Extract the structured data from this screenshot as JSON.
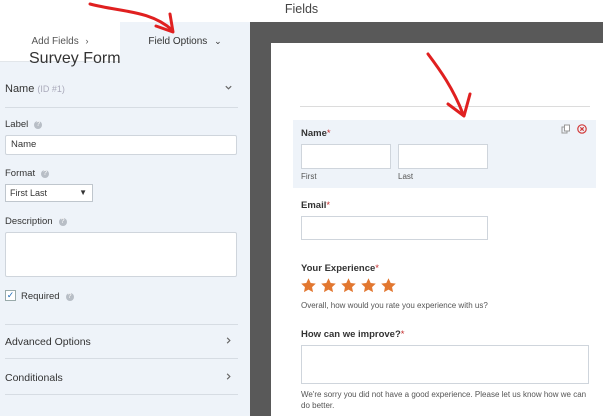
{
  "window": {
    "title": "Fields"
  },
  "tabs": {
    "add_fields": "Add Fields",
    "add_fields_caret": "›",
    "field_options": "Field Options",
    "field_options_caret": "⌄"
  },
  "options": {
    "field_name": "Name",
    "field_id": "(ID #1)",
    "label_title": "Label",
    "label_value": "Name",
    "format_title": "Format",
    "format_value": "First Last",
    "description_title": "Description",
    "description_value": "",
    "required_label": "Required",
    "required_checked": true,
    "advanced_options": "Advanced Options",
    "conditionals": "Conditionals",
    "help_glyph": "?"
  },
  "preview": {
    "form_title": "Survey Form",
    "name_label": "Name",
    "first_sublabel": "First",
    "last_sublabel": "Last",
    "email_label": "Email",
    "experience_label": "Your Experience",
    "star_count": 5,
    "rating_value": 5,
    "experience_hint": "Overall, how would you rate you experience with us?",
    "improve_label": "How can we improve?",
    "improve_hint": "We're sorry you did not have a good experience. Please let us know how we can do better.",
    "required_mark": "*"
  },
  "colors": {
    "accent": "#e27730",
    "required": "#c62e2e",
    "arrow": "#e02020"
  },
  "icons": [
    "chevron-down-icon",
    "chevron-right-icon",
    "help-icon",
    "checkbox-icon",
    "duplicate-icon",
    "delete-icon",
    "star-icon",
    "arrow-annotation-icon"
  ]
}
